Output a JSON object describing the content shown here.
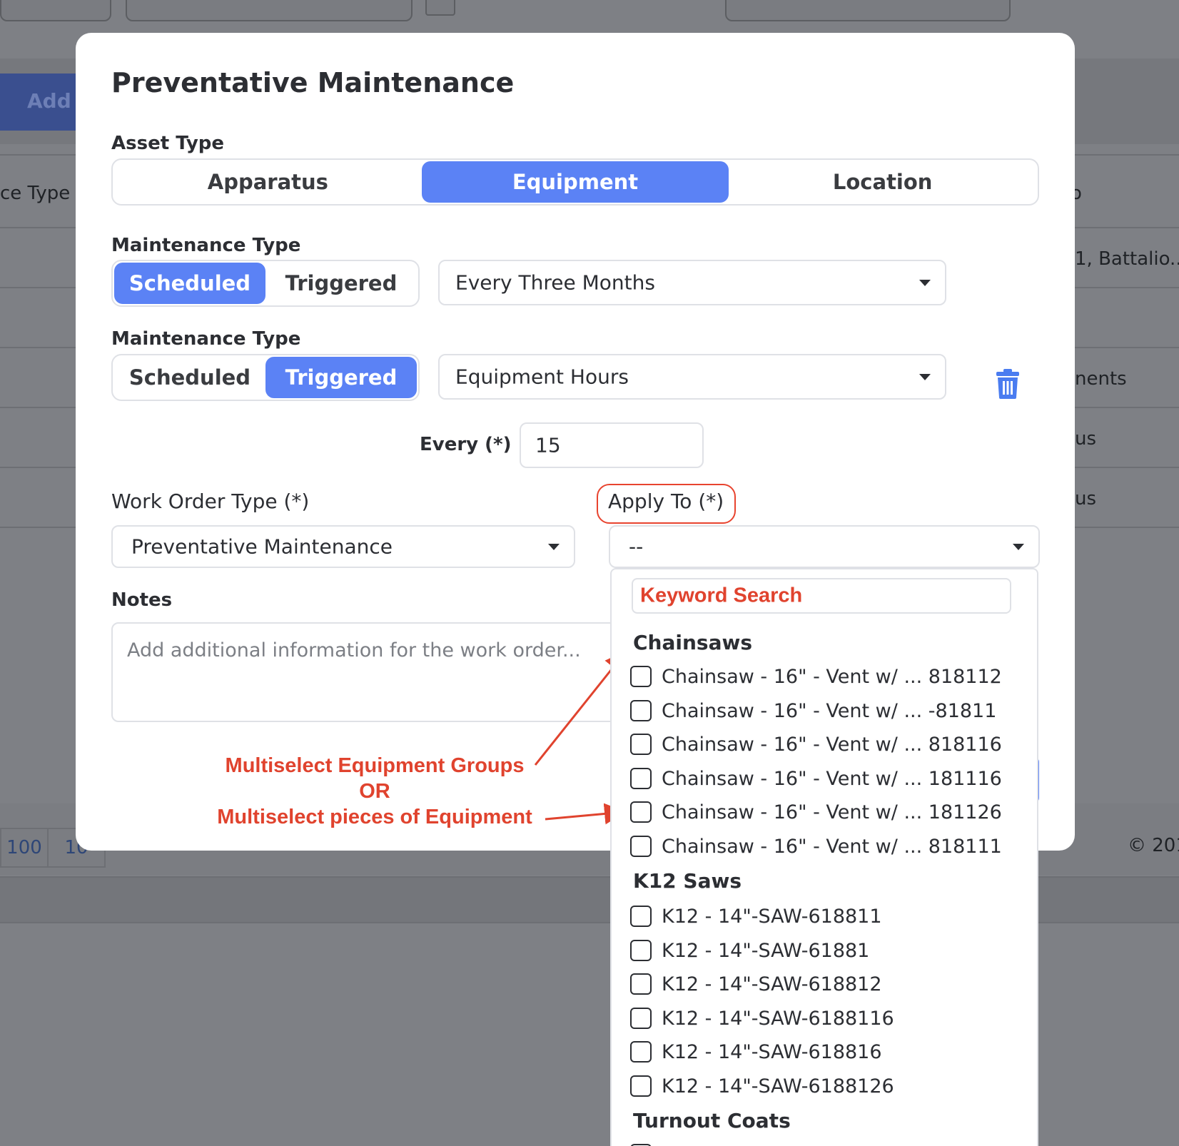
{
  "background": {
    "add_button_label": "Add",
    "col_header_left": "ce Type",
    "col_header_right": "o",
    "row_texts": [
      "1, Battalio...",
      "nents",
      "us",
      "us"
    ],
    "pager": [
      "100",
      "10"
    ],
    "copyright": "© 201"
  },
  "modal": {
    "title": "Preventative Maintenance",
    "asset_type": {
      "label": "Asset Type",
      "options": [
        "Apparatus",
        "Equipment",
        "Location"
      ],
      "selected": "Equipment"
    },
    "maintenance_1": {
      "label": "Maintenance Type",
      "options": [
        "Scheduled",
        "Triggered"
      ],
      "selected": "Scheduled",
      "frequency": "Every Three Months"
    },
    "maintenance_2": {
      "label": "Maintenance Type",
      "options": [
        "Scheduled",
        "Triggered"
      ],
      "selected": "Triggered",
      "trigger": "Equipment Hours",
      "every_label": "Every (*)",
      "every_value": "15"
    },
    "work_order_type": {
      "label": "Work Order Type (*)",
      "value": "Preventative Maintenance"
    },
    "apply_to": {
      "label": "Apply To (*)",
      "value": "--"
    },
    "notes": {
      "label": "Notes",
      "placeholder": "Add additional information for the work order..."
    }
  },
  "dropdown": {
    "keyword_search": "Keyword Search",
    "groups": [
      {
        "name": "Chainsaws",
        "items": [
          "Chainsaw - 16\" - Vent w/ ... 818112",
          "Chainsaw - 16\" - Vent w/ ... -81811",
          "Chainsaw - 16\" - Vent w/ ... 818116",
          "Chainsaw - 16\" - Vent w/ ... 181116",
          "Chainsaw - 16\" - Vent w/ ... 181126",
          "Chainsaw - 16\" - Vent w/ ... 818111"
        ]
      },
      {
        "name": "K12 Saws",
        "items": [
          "K12 - 14\"-SAW-618811",
          "K12 - 14\"-SAW-61881",
          "K12 - 14\"-SAW-618812",
          "K12 - 14\"-SAW-6188116",
          "K12 - 14\"-SAW-618816",
          "K12 - 14\"-SAW-6188126"
        ]
      },
      {
        "name": "Turnout Coats",
        "items": []
      }
    ]
  },
  "annotation": {
    "line1": "Multiselect Equipment Groups",
    "line2": "OR",
    "line3": "Multiselect pieces of Equipment",
    "color": "#e0432e"
  },
  "colors": {
    "accent": "#5b82f5",
    "annotation": "#e0432e",
    "trash": "#4a7cf0"
  }
}
